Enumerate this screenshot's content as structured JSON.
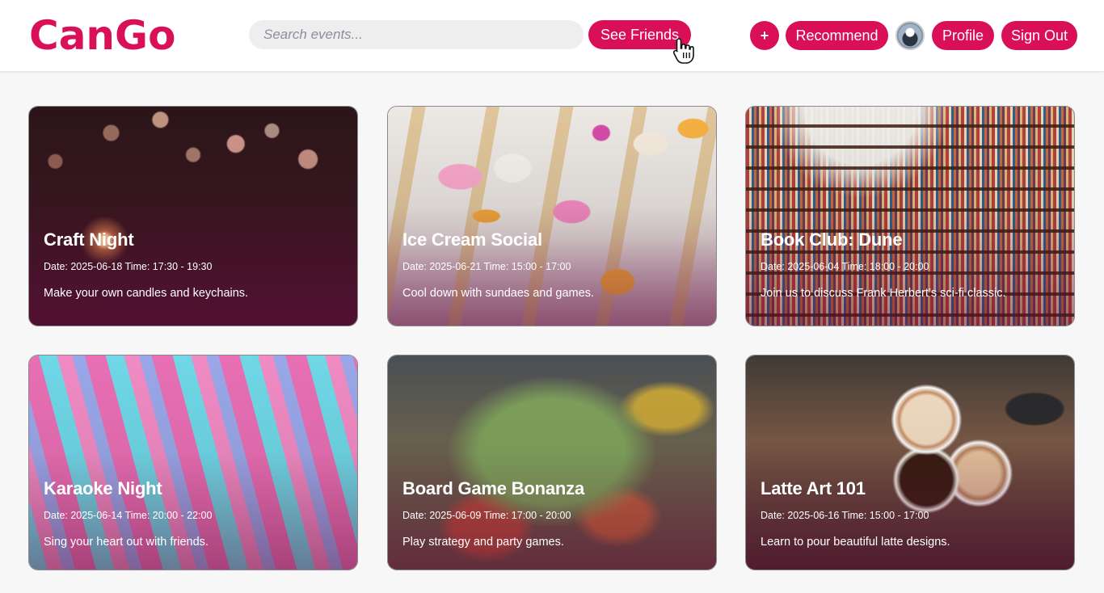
{
  "app": {
    "logo": "CanGo"
  },
  "search": {
    "placeholder": "Search events..."
  },
  "nav": {
    "see_friends": "See Friends",
    "add": "+",
    "recommend": "Recommend",
    "profile": "Profile",
    "sign_out": "Sign Out"
  },
  "colors": {
    "accent": "#d90f57",
    "background": "#f7f7f8"
  },
  "events": [
    {
      "title": "Craft Night",
      "meta": "Date: 2025-06-18 Time: 17:30 - 19:30",
      "description": "Make your own candles and keychains."
    },
    {
      "title": "Ice Cream Social",
      "meta": "Date: 2025-06-21 Time: 15:00 - 17:00",
      "description": "Cool down with sundaes and games."
    },
    {
      "title": "Book Club: Dune",
      "meta": "Date: 2025-06-04 Time: 18:00 - 20:00",
      "description": "Join us to discuss Frank Herbert’s sci-fi classic."
    },
    {
      "title": "Karaoke Night",
      "meta": "Date: 2025-06-14 Time: 20:00 - 22:00",
      "description": "Sing your heart out with friends."
    },
    {
      "title": "Board Game Bonanza",
      "meta": "Date: 2025-06-09 Time: 17:00 - 20:00",
      "description": "Play strategy and party games."
    },
    {
      "title": "Latte Art 101",
      "meta": "Date: 2025-06-16 Time: 15:00 - 17:00",
      "description": "Learn to pour beautiful latte designs."
    }
  ]
}
